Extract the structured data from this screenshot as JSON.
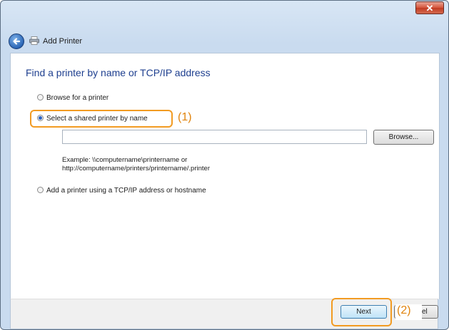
{
  "window": {
    "close_label": "✕"
  },
  "wizard": {
    "title": "Add Printer"
  },
  "content": {
    "heading": "Find a printer by name or TCP/IP address",
    "options": [
      {
        "label": "Browse for a printer",
        "selected": false
      },
      {
        "label": "Select a shared printer by name",
        "selected": true
      },
      {
        "label": "Add a printer using a TCP/IP address or hostname",
        "selected": false
      }
    ],
    "printer_name_value": "",
    "browse_label": "Browse...",
    "example_line1": "Example: \\\\computername\\printername or",
    "example_line2": "http://computername/printers/printername/.printer"
  },
  "footer": {
    "next_label": "Next",
    "cancel_label_visible": "el"
  },
  "annotations": {
    "callout1": "(1)",
    "callout2": "(2)",
    "highlight_color": "#f29b22"
  },
  "icons": {
    "back": "back-arrow-icon",
    "printer": "printer-icon",
    "close": "close-icon"
  }
}
